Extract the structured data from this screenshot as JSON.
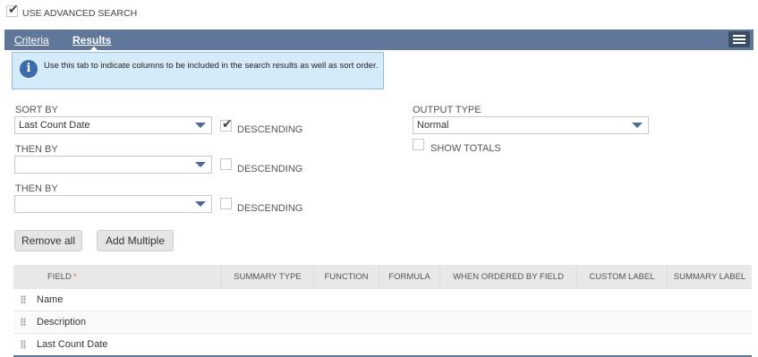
{
  "advanced_search": {
    "label": "USE ADVANCED SEARCH",
    "checked": true
  },
  "tabs": [
    {
      "label": "Criteria",
      "active": false
    },
    {
      "label": "Results",
      "active": true
    }
  ],
  "info": {
    "text": "Use this tab to indicate columns to be included in the search results as well as sort order."
  },
  "sort": {
    "sort_by_label": "SORT BY",
    "sort_by_value": "Last Count Date",
    "sort_by_descending": true,
    "then_by_label_1": "THEN BY",
    "then_by_value_1": "",
    "then_by_descending_1": false,
    "then_by_label_2": "THEN BY",
    "then_by_value_2": "",
    "then_by_descending_2": false,
    "descending_label": "DESCENDING"
  },
  "output": {
    "label": "OUTPUT TYPE",
    "value": "Normal",
    "show_totals_label": "SHOW TOTALS",
    "show_totals": false
  },
  "buttons": {
    "remove_all": "Remove all",
    "add_multiple": "Add Multiple"
  },
  "table": {
    "headers": [
      "FIELD",
      "SUMMARY TYPE",
      "FUNCTION",
      "FORMULA",
      "WHEN ORDERED BY FIELD",
      "CUSTOM LABEL",
      "SUMMARY LABEL"
    ],
    "required_mark": "*",
    "rows": [
      {
        "field": "Name"
      },
      {
        "field": "Description"
      },
      {
        "field": "Last Count Date"
      }
    ]
  },
  "colors": {
    "tab_bar": "#607799",
    "info_bg": "#d4ecf9",
    "arrow": "#4a6a95"
  }
}
